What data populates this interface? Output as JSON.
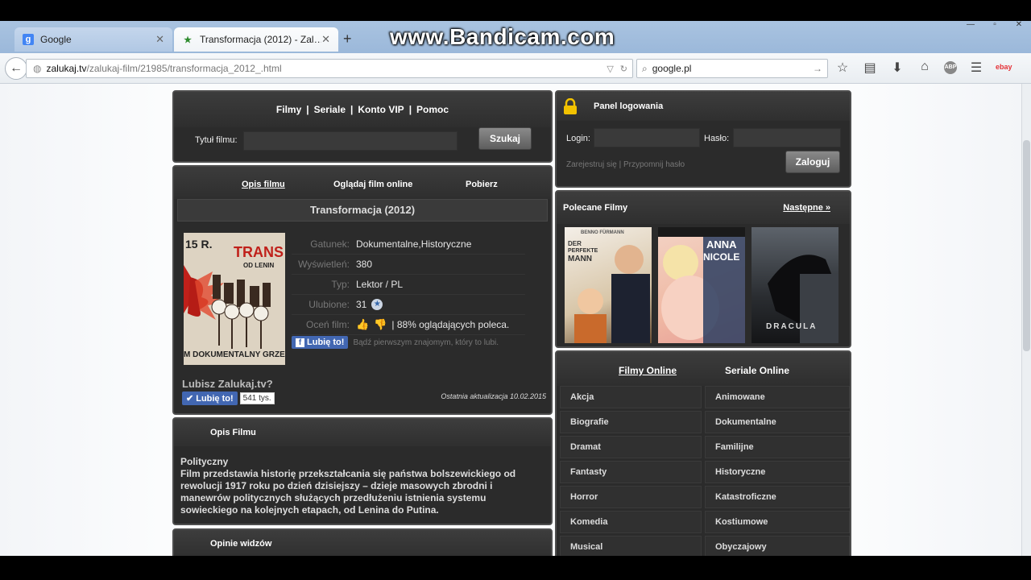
{
  "browser": {
    "tabs": [
      {
        "label": "Google",
        "icon": "google-icon"
      },
      {
        "label": "Transformacja (2012) - Zal…",
        "icon": "star-icon"
      }
    ],
    "url_host": "zalukaj.tv",
    "url_path": "/zalukaj-film/21985/transformacja_2012_.html",
    "search_value": "google.pl",
    "watermark": "www.Bandicam.com"
  },
  "site": {
    "menu": [
      "Filmy",
      "|",
      "Seriale",
      "|",
      "Konto VIP",
      "|",
      "Pomoc"
    ],
    "search_label": "Tytuł filmu:",
    "search_button": "Szukaj",
    "login": {
      "title": "Panel logowania",
      "login_label": "Login:",
      "password_label": "Hasło:",
      "links": "Zarejestruj się | Przypomnij hasło",
      "button": "Zaloguj"
    },
    "film_tabs": [
      "Opis filmu",
      "Oglądaj film online",
      "Pobierz"
    ],
    "film": {
      "title": "Transformacja (2012)",
      "poster_top_text": "15 R.",
      "poster_title": "TRANS",
      "poster_sub": "OD LENIN",
      "poster_bottom_text": "M DOKUMENTALNY GRZE",
      "rows": [
        {
          "key": "Gatunek:",
          "value": "Dokumentalne,Historyczne"
        },
        {
          "key": "Wyświetleń:",
          "value": "380"
        },
        {
          "key": "Typ:",
          "value": "Lektor / PL"
        },
        {
          "key": "Ulubione:",
          "value": "31"
        },
        {
          "key": "Oceń film:",
          "value": "| 88% oglądających poleca."
        }
      ],
      "fb_like_label": "Lubię to!",
      "fb_text": "Bądź pierwszym znajomym, który to lubi.",
      "lubisz": "Lubisz Zalukaj.tv?",
      "fb_like2": "Lubię to!",
      "fb_count": "541 tys.",
      "last_update": "Ostatnia aktualizacja 10.02.2015"
    },
    "opis": {
      "title": "Opis Filmu",
      "genre_line": "Polityczny",
      "text": "Film przedstawia historię przekształcania się państwa bolszewickiego od rewolucji 1917 roku po dzień dzisiejszy – dzieje masowych zbrodni i manewrów politycznych służących przedłużeniu istnienia systemu sowieckiego na kolejnych etapach, od Lenina do Putina."
    },
    "opinie_title": "Opinie widzów",
    "polecane": {
      "title": "Polecane Filmy",
      "next": "Następne »",
      "posters": [
        {
          "t1": "DER",
          "t2": "PERFEKTE",
          "t3": "MANN",
          "t4": "BENNO FÜRMANN"
        },
        {
          "t1": "ANNA",
          "t2": "NICOLE",
          "t3": "",
          "t4": ""
        },
        {
          "t1": "DRACULA",
          "t2": "",
          "t3": "",
          "t4": ""
        }
      ]
    },
    "cats_tabs": [
      "Filmy Online",
      "Seriale Online"
    ],
    "categories": [
      "Akcja",
      "Animowane",
      "Biografie",
      "Dokumentalne",
      "Dramat",
      "Familijne",
      "Fantasty",
      "Historyczne",
      "Horror",
      "Katastroficzne",
      "Komedia",
      "Kostiumowe",
      "Musical",
      "Obyczajowy"
    ]
  },
  "colors": {
    "panel_bg": "#2b2b2b",
    "fb_blue": "#4267b2",
    "lock_yellow": "#f2c200"
  }
}
